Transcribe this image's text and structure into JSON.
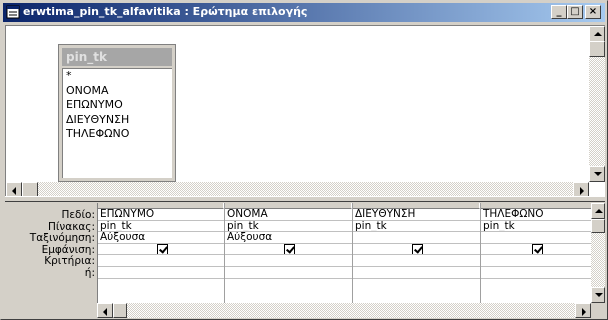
{
  "window": {
    "title": "erwtima_pin_tk_alfavitika : Ερώτημα επιλογής",
    "buttons": {
      "minimize": "_",
      "maximize": "□",
      "close": "×"
    }
  },
  "table_box": {
    "name": "pin_tk",
    "fields": [
      "*",
      "ΟΝΟΜΑ",
      "ΕΠΩΝΥΜΟ",
      "ΔΙΕΥΘΥΝΣΗ",
      "ΤΗΛΕΦΩΝΟ"
    ]
  },
  "grid": {
    "row_labels": [
      "Πεδίο:",
      "Πίνακας:",
      "Ταξινόμηση:",
      "Εμφάνιση:",
      "Κριτήρια:",
      "ή:"
    ],
    "columns": [
      {
        "field": "ΕΠΩΝΥΜΟ",
        "table": "pin_tk",
        "sort": "Αύξουσα",
        "show": true
      },
      {
        "field": "ΟΝΟΜΑ",
        "table": "pin_tk",
        "sort": "Αύξουσα",
        "show": true
      },
      {
        "field": "ΔΙΕΥΘΥΝΣΗ",
        "table": "pin_tk",
        "sort": "",
        "show": true
      },
      {
        "field": "ΤΗΛΕΦΩΝΟ",
        "table": "pin_tk",
        "sort": "",
        "show": true
      }
    ]
  }
}
